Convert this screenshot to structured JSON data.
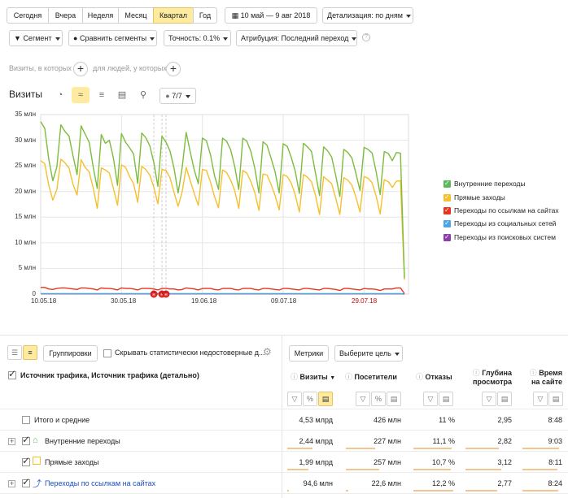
{
  "period_tabs": [
    "Сегодня",
    "Вчера",
    "Неделя",
    "Месяц",
    "Квартал",
    "Год"
  ],
  "period_active": "Квартал",
  "date_range": "10 май — 9 авг 2018",
  "detail": "Детализация: по дням",
  "filters": {
    "segment": "Сегмент",
    "compare": "Сравнить сегменты",
    "accuracy": "Точность: 0.1%",
    "attribution": "Атрибуция: Последний переход"
  },
  "segment_builder": {
    "visits_label": "Визиты, в которых",
    "people_label": "для людей, у которых"
  },
  "chart_header": {
    "title": "Визиты",
    "series_counter": "7/7"
  },
  "chart_data": {
    "type": "line",
    "title": "Визиты",
    "y_ticks": [
      "35 млн",
      "30 млн",
      "25 млн",
      "20 млн",
      "15 млн",
      "10 млн",
      "5 млн",
      "0"
    ],
    "ylim": [
      0,
      35
    ],
    "x_ticks": [
      "10.05.18",
      "30.05.18",
      "19.06.18",
      "09.07.18",
      "29.07.18"
    ],
    "x_tick_colors": [
      "#333333",
      "#333333",
      "#333333",
      "#333333",
      "#cc0000"
    ],
    "xlim": [
      0,
      91
    ],
    "series": [
      {
        "name": "Внутренние переходы",
        "color": "#7dbc3d",
        "values": [
          33.6,
          32.3,
          26.3,
          22.1,
          24.8,
          33,
          31.7,
          30.8,
          27,
          23.3,
          32.8,
          31.2,
          29.6,
          24.7,
          20.6,
          31.1,
          29.4,
          30,
          26.5,
          21.2,
          31.3,
          29.6,
          28.5,
          27.3,
          21.6,
          31.4,
          30.5,
          28.9,
          25.6,
          21,
          30.8,
          29.6,
          27.9,
          24.5,
          19.7,
          24.6,
          31.5,
          27.7,
          24.2,
          21.5,
          30.4,
          29.9,
          27.2,
          23.1,
          20.4,
          30.4,
          29.8,
          28.1,
          24.9,
          20.4,
          30.4,
          29.8,
          27.8,
          24.4,
          19.7,
          29.7,
          29,
          26.5,
          23.8,
          19.7,
          29.3,
          28.8,
          26.6,
          23.9,
          19.6,
          29.4,
          28.7,
          27.8,
          23.5,
          19.2,
          28.7,
          27.9,
          26.7,
          23.1,
          19,
          28.2,
          27.6,
          26.5,
          23.5,
          20.2,
          28.6,
          28.2,
          27.5,
          23.8,
          19.4,
          27.8,
          27.4,
          26,
          27.6,
          27.5,
          3.1
        ]
      },
      {
        "name": "Прямые заходы",
        "color": "#f5c02e",
        "values": [
          26,
          25.4,
          21.2,
          18.3,
          20.4,
          26.3,
          25.6,
          24.6,
          21.4,
          19.3,
          26.2,
          24.7,
          23.8,
          20.7,
          16.7,
          24.6,
          24.2,
          23.6,
          20.6,
          17.3,
          25.2,
          24.7,
          22.9,
          21.5,
          17.9,
          24.9,
          24.3,
          23.2,
          20.8,
          17.6,
          24.3,
          24.1,
          22.7,
          19.8,
          17.1,
          19.9,
          24.7,
          22.1,
          19.6,
          17.3,
          24.3,
          24.1,
          21.9,
          19,
          16.8,
          24.2,
          23.7,
          22.2,
          20.2,
          16.7,
          24.1,
          23.6,
          21.9,
          19.7,
          16.3,
          23.4,
          23.2,
          21.4,
          19.2,
          16.4,
          23.3,
          22.9,
          21.6,
          19.3,
          16,
          23.3,
          22.8,
          21.9,
          19.2,
          15.5,
          22.9,
          22.2,
          21.5,
          18.7,
          15.5,
          22.7,
          22.2,
          21.2,
          18.9,
          16,
          22.9,
          22.6,
          21.7,
          19.1,
          15.6,
          22.3,
          21.9,
          20.8,
          22,
          22.1,
          2.8
        ]
      },
      {
        "name": "Переходы по ссылкам на сайтах",
        "color": "#e8351e",
        "values": [
          1.3,
          1.3,
          1,
          0.9,
          1.1,
          1.2,
          1.2,
          1.1,
          1,
          0.9,
          1.2,
          1.2,
          1.1,
          1,
          0.8,
          1.2,
          1.1,
          1.1,
          1,
          0.8,
          1.2,
          1.1,
          1.1,
          1,
          0.8,
          1.1,
          1.1,
          1.1,
          1,
          0.8,
          1.1,
          1.1,
          1,
          1,
          0.8,
          0.9,
          1.2,
          1.1,
          1,
          0.8,
          1.1,
          1.1,
          1.1,
          0.9,
          0.8,
          1.1,
          1.1,
          1.1,
          0.9,
          0.8,
          1.1,
          1.1,
          1.1,
          0.9,
          0.8,
          1.1,
          1.1,
          1,
          0.9,
          0.8,
          1.1,
          1.1,
          1,
          0.9,
          0.8,
          1.1,
          1.1,
          1,
          0.9,
          0.8,
          1.1,
          1.1,
          1,
          0.9,
          0.7,
          1.1,
          1.1,
          1,
          0.9,
          0.8,
          1.1,
          1,
          1,
          0.9,
          0.7,
          1,
          1,
          1,
          1.2,
          1.2,
          0.1
        ]
      },
      {
        "name": "Переходы из социальных сетей",
        "color": "#4aa6e8",
        "values": [
          0.1,
          0.1,
          0.1,
          0.1,
          0.1,
          0.1,
          0.1,
          0.1,
          0.1,
          0.1,
          0.1,
          0.1,
          0.1,
          0.1,
          0.1,
          0.1,
          0.1,
          0.1,
          0.1,
          0.1,
          0.1,
          0.1,
          0.1,
          0.1,
          0.1,
          0.1,
          0.1,
          0.1,
          0.1,
          0.1,
          0.1,
          0.1,
          0.1,
          0.1,
          0.1,
          0.1,
          0.1,
          0.1,
          0.1,
          0.1,
          0.1,
          0.1,
          0.1,
          0.1,
          0.1,
          0.1,
          0.1,
          0.1,
          0.1,
          0.1,
          0.1,
          0.1,
          0.1,
          0.1,
          0.1,
          0.1,
          0.1,
          0.1,
          0.1,
          0.1,
          0.1,
          0.1,
          0.1,
          0.1,
          0.1,
          0.1,
          0.1,
          0.1,
          0.1,
          0.1,
          0.1,
          0.1,
          0.1,
          0.1,
          0.1,
          0.1,
          0.1,
          0.1,
          0.1,
          0.1,
          0.1,
          0.1,
          0.1,
          0.1,
          0.1,
          0.1,
          0.1,
          0.1,
          0.1,
          0.1,
          0
        ]
      },
      {
        "name": "Переходы из поисковых систем",
        "color": "#8b3fa8",
        "values": [
          0.05,
          0.05,
          0.05,
          0.05,
          0.05,
          0.05,
          0.05,
          0.05,
          0.05,
          0.05,
          0.05,
          0.05,
          0.05,
          0.05,
          0.05,
          0.05,
          0.05,
          0.05,
          0.05,
          0.05,
          0.05,
          0.05,
          0.05,
          0.05,
          0.05,
          0.05,
          0.05,
          0.05,
          0.05,
          0.05,
          0.05,
          0.05,
          0.05,
          0.05,
          0.05,
          0.05,
          0.05,
          0.05,
          0.05,
          0.05,
          0.05,
          0.05,
          0.05,
          0.05,
          0.05,
          0.05,
          0.05,
          0.05,
          0.05,
          0.05,
          0.05,
          0.05,
          0.05,
          0.05,
          0.05,
          0.05,
          0.05,
          0.05,
          0.05,
          0.05,
          0.05,
          0.05,
          0.05,
          0.05,
          0.05,
          0.05,
          0.05,
          0.05,
          0.05,
          0.05,
          0.05,
          0.05,
          0.05,
          0.05,
          0.05,
          0.05,
          0.05,
          0.05,
          0.05,
          0.05,
          0.05,
          0.05,
          0.05,
          0.05,
          0.05,
          0.05,
          0.05,
          0.05,
          0.05,
          0.05,
          0
        ]
      }
    ],
    "legend_position": "right",
    "grid": true,
    "annotations": [
      {
        "x": 28,
        "label": "н"
      },
      {
        "x": 30,
        "label": "н"
      },
      {
        "x": 31,
        "label": "н"
      }
    ]
  },
  "legend": [
    {
      "label": "Внутренние переходы",
      "color": "#5cb85c"
    },
    {
      "label": "Прямые заходы",
      "color": "#f5c02e"
    },
    {
      "label": "Переходы по ссылкам на сайтах",
      "color": "#e8351e"
    },
    {
      "label": "Переходы из социальных сетей",
      "color": "#4aa6e8"
    },
    {
      "label": "Переходы из поисковых систем",
      "color": "#8b3fa8"
    }
  ],
  "table_toolbar": {
    "grouping": "Группировки",
    "hide_label": "Скрывать статистически недостоверные д...",
    "metrics": "Метрики",
    "goal": "Выберите цель"
  },
  "table": {
    "dimension_header": "Источник трафика, Источник трафика (детально)",
    "columns": [
      {
        "label": "Визиты",
        "sorted": true
      },
      {
        "label": "Посетители"
      },
      {
        "label": "Отказы"
      },
      {
        "label": "Глубина просмотра"
      },
      {
        "label": "Время на сайте"
      }
    ],
    "totals": {
      "label": "Итого и средние",
      "values": [
        "4,53 млрд",
        "426 млн",
        "11 %",
        "2,95",
        "8:48"
      ]
    },
    "rows": [
      {
        "label": "Внутренние переходы",
        "values": [
          "2,44 млрд",
          "227 млн",
          "11,1 %",
          "2,82",
          "9:03"
        ],
        "icon": "home-icon",
        "bar_fractions": [
          0.54,
          0.53,
          0.9,
          0.7,
          0.9
        ]
      },
      {
        "label": "Прямые заходы",
        "values": [
          "1,99 млрд",
          "257 млн",
          "10,7 %",
          "3,12",
          "8:11"
        ],
        "icon": "direct-icon",
        "bar_fractions": [
          0.44,
          0.6,
          0.88,
          0.75,
          0.85
        ]
      },
      {
        "label": "Переходы по ссылкам на сайтах",
        "values": [
          "94,6 млн",
          "22,6 млн",
          "12,2 %",
          "2,77",
          "8:24"
        ],
        "icon": "link-icon",
        "bar_fractions": [
          0.04,
          0.05,
          0.95,
          0.68,
          0.87
        ]
      }
    ]
  }
}
